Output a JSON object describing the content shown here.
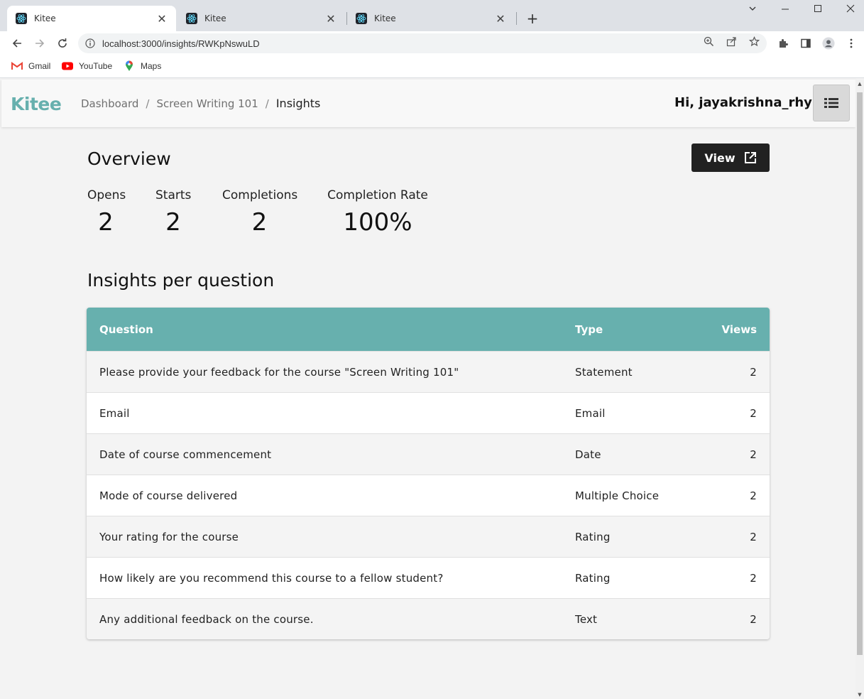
{
  "browser": {
    "tabs": [
      {
        "title": "Kitee",
        "active": true
      },
      {
        "title": "Kitee",
        "active": false
      },
      {
        "title": "Kitee",
        "active": false
      }
    ],
    "url": "localhost:3000/insights/RWKpNswuLD",
    "bookmarks": [
      {
        "label": "Gmail",
        "icon": "gmail-icon"
      },
      {
        "label": "YouTube",
        "icon": "youtube-icon"
      },
      {
        "label": "Maps",
        "icon": "maps-icon"
      }
    ]
  },
  "app": {
    "logo": "Kitee",
    "breadcrumb": [
      "Dashboard",
      "Screen Writing 101",
      "Insights"
    ],
    "greeting": "Hi, jayakrishna_rhy",
    "accent_color": "#67b0ae"
  },
  "overview": {
    "title": "Overview",
    "view_label": "View",
    "stats": [
      {
        "label": "Opens",
        "value": "2"
      },
      {
        "label": "Starts",
        "value": "2"
      },
      {
        "label": "Completions",
        "value": "2"
      },
      {
        "label": "Completion Rate",
        "value": "100%"
      }
    ]
  },
  "insights": {
    "title": "Insights per question",
    "columns": [
      "Question",
      "Type",
      "Views"
    ],
    "rows": [
      {
        "question": "Please provide your feedback for the course \"Screen Writing 101\"",
        "type": "Statement",
        "views": "2"
      },
      {
        "question": "Email",
        "type": "Email",
        "views": "2"
      },
      {
        "question": "Date of course commencement",
        "type": "Date",
        "views": "2"
      },
      {
        "question": "Mode of course delivered",
        "type": "Multiple Choice",
        "views": "2"
      },
      {
        "question": "Your rating for the course",
        "type": "Rating",
        "views": "2"
      },
      {
        "question": "How likely are you recommend this course to a fellow student?",
        "type": "Rating",
        "views": "2"
      },
      {
        "question": "Any additional feedback on the course.",
        "type": "Text",
        "views": "2"
      }
    ]
  }
}
